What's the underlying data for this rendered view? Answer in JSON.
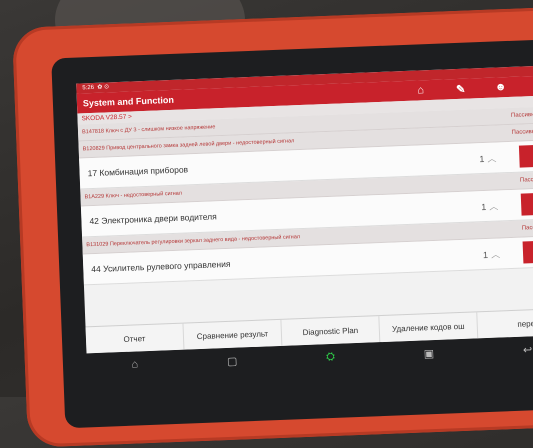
{
  "status_bar": {
    "time": "5:26"
  },
  "app_bar": {
    "title": "System and Function",
    "icons": [
      "home-icon",
      "report-icon",
      "user-icon",
      "settings-icon"
    ]
  },
  "breadcrumb": "SKODA V28.57 >",
  "rows": [
    {
      "kind": "fault",
      "text": "B147818 Ключ с ДУ 3 - слишком низкое напряжение",
      "status": "Пассивн/Спорадич"
    },
    {
      "kind": "fault",
      "text": "B120829 Привод центрального замка задней левой двери - недостоверный сигнал",
      "status": "Пассивн/Спорадич"
    },
    {
      "kind": "system",
      "name": "17 Комбинация приборов",
      "count": "1"
    },
    {
      "kind": "fault",
      "text": "B1A229 Ключ - недостоверный сигнал",
      "status": "Пассивн/Спорад"
    },
    {
      "kind": "system",
      "name": "42 Электроника двери водителя",
      "count": "1"
    },
    {
      "kind": "fault",
      "text": "B131029 Переключатель регулировки зеркал заднего вида - недостоверный сигнал",
      "status": "Пассивн/Спорад"
    },
    {
      "kind": "system",
      "name": "44 Усилитель рулевого управления",
      "count": "1"
    }
  ],
  "bottom_buttons": [
    "Отчет",
    "Сравнение результ",
    "Diagnostic Plan",
    "Удаление кодов ош",
    "пере"
  ],
  "nav_icons": [
    "home-icon",
    "recent-apps-icon",
    "vci-icon",
    "screenshot-icon",
    "back-icon"
  ]
}
